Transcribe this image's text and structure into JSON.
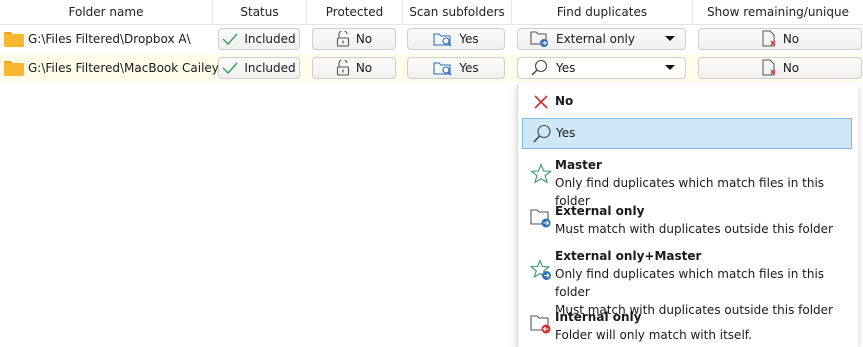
{
  "columns": {
    "folder_name": "Folder name",
    "status": "Status",
    "protected": "Protected",
    "scan_subfolders": "Scan subfolders",
    "find_duplicates": "Find duplicates",
    "show_remaining": "Show remaining/unique files"
  },
  "rows": [
    {
      "folder": "G:\\Files Filtered\\Dropbox A\\",
      "status": "Included",
      "protected": "No",
      "scan_subfolders": "Yes",
      "find_duplicates": "External only",
      "show_remaining": "No"
    },
    {
      "folder": "G:\\Files Filtered\\MacBook Cailey\\",
      "status": "Included",
      "protected": "No",
      "scan_subfolders": "Yes",
      "find_duplicates": "Yes",
      "show_remaining": "No"
    }
  ],
  "dropdown": {
    "options": [
      {
        "title": "No",
        "icon": "red-x-icon"
      },
      {
        "title": "Yes",
        "icon": "magnifier-icon",
        "selected": true
      },
      {
        "title": "Master",
        "desc": [
          "Only find duplicates which match files in this folder"
        ],
        "icon": "star-icon"
      },
      {
        "title": "External only",
        "desc": [
          "Must match with duplicates outside this folder"
        ],
        "icon": "folder-arrow-out-icon"
      },
      {
        "title": "External only+Master",
        "desc": [
          "Only find duplicates which match files in this folder",
          "Must match with duplicates outside this folder"
        ],
        "icon": "star-arrow-icon"
      },
      {
        "title": "Internal only",
        "desc": [
          "Folder will only match with itself."
        ],
        "icon": "folder-arrow-in-icon"
      }
    ]
  },
  "colors": {
    "folder": "#f8b930",
    "selection": "#cfe8f7",
    "row_highlight": "#fffde9",
    "accent_blue": "#2f6fb3",
    "star_green": "#3a9a6a",
    "red": "#d32f2f"
  }
}
